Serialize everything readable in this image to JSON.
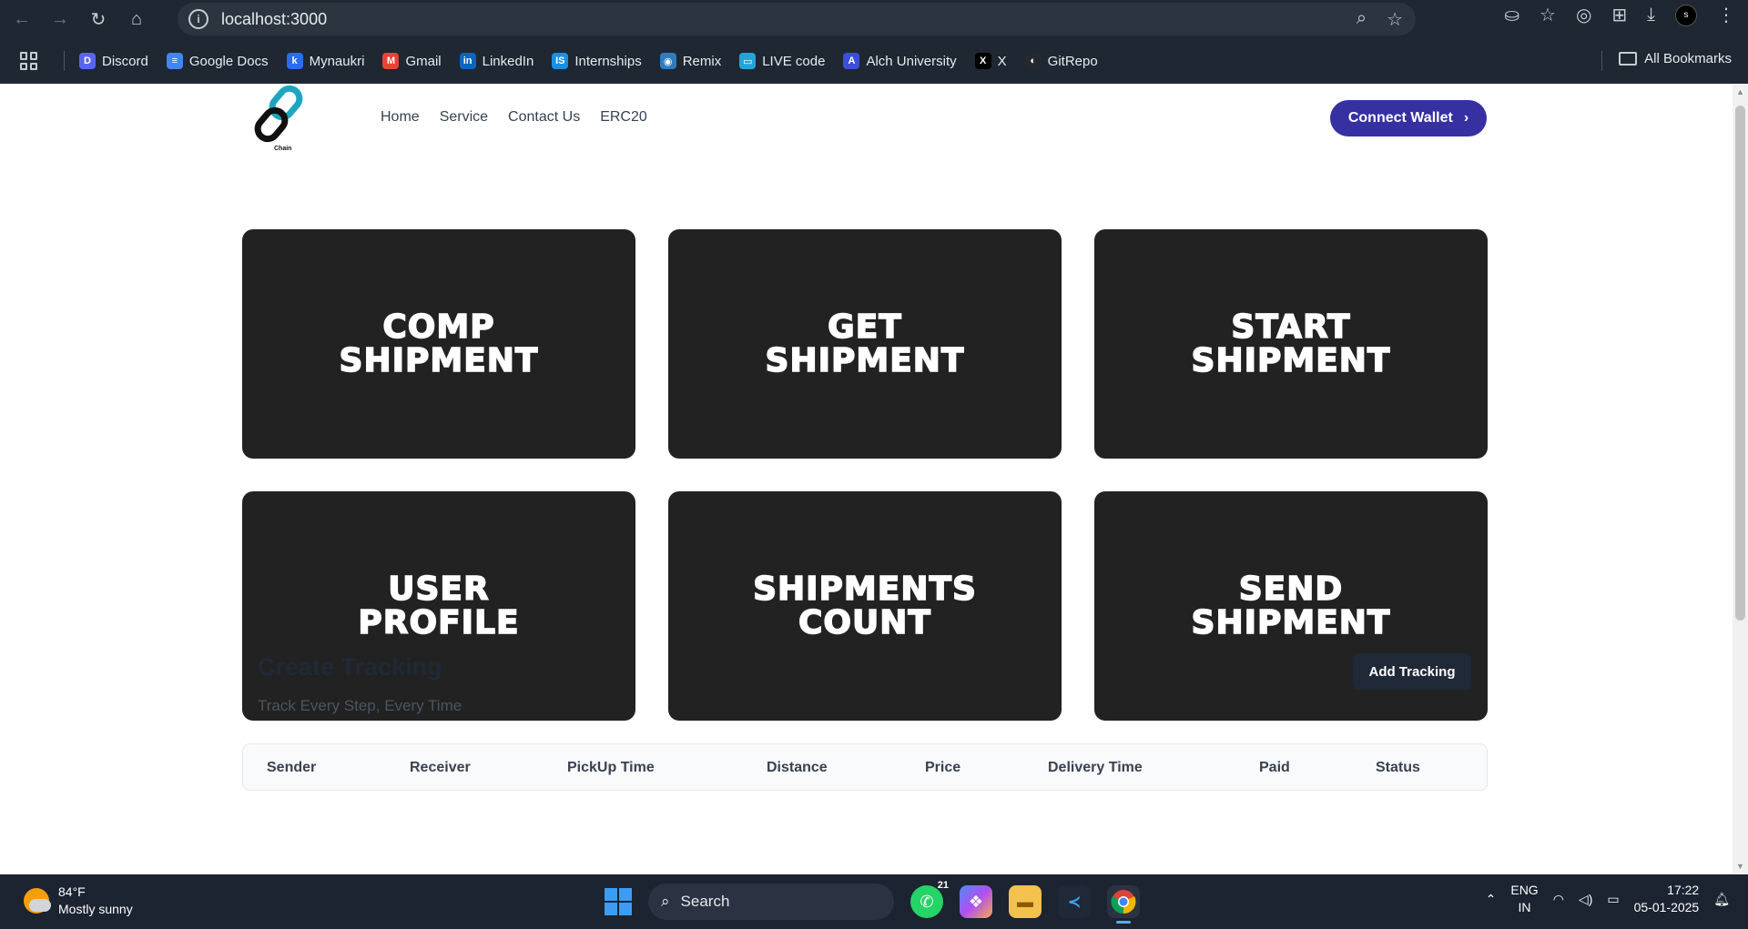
{
  "browser": {
    "url": "localhost:3000",
    "bookmarks": [
      {
        "label": "Discord",
        "color": "#5865f2",
        "glyph": "D"
      },
      {
        "label": "Google Docs",
        "color": "#4285f4",
        "glyph": "≡"
      },
      {
        "label": "Mynaukri",
        "color": "#2b6cf0",
        "glyph": "k"
      },
      {
        "label": "Gmail",
        "color": "#ea4335",
        "glyph": "M"
      },
      {
        "label": "LinkedIn",
        "color": "#0a66c2",
        "glyph": "in"
      },
      {
        "label": "Internships",
        "color": "#1d8fe1",
        "glyph": "IS"
      },
      {
        "label": "Remix",
        "color": "#2e7dbe",
        "glyph": "◉"
      },
      {
        "label": "LIVE code",
        "color": "#22a6d8",
        "glyph": "▭"
      },
      {
        "label": "Alch University",
        "color": "#3b4fd8",
        "glyph": "A"
      },
      {
        "label": "X",
        "color": "#000000",
        "glyph": "X"
      },
      {
        "label": "GitRepo",
        "color": "#24292e",
        "glyph": "◐"
      }
    ],
    "all_bookmarks": "All Bookmarks",
    "avatar_letter": "s"
  },
  "site": {
    "logo_text": "Chain",
    "nav": [
      "Home",
      "Service",
      "Contact Us",
      "ERC20"
    ],
    "connect_label": "Connect Wallet",
    "cards": [
      "COMP SHIPMENT",
      "GET SHIPMENT",
      "START SHIPMENT",
      "USER PROFILE",
      "SHIPMENTS COUNT",
      "SEND SHIPMENT"
    ],
    "tracking": {
      "title": "Create Tracking",
      "subtitle": "Track Every Step, Every Time",
      "add_label": "Add Tracking",
      "columns": [
        "Sender",
        "Receiver",
        "PickUp Time",
        "Distance",
        "Price",
        "Delivery Time",
        "Paid",
        "Status"
      ]
    }
  },
  "taskbar": {
    "temp": "84°F",
    "weather": "Mostly sunny",
    "search_placeholder": "Search",
    "whatsapp_badge": "21",
    "lang1": "ENG",
    "lang2": "IN",
    "time": "17:22",
    "date": "05-01-2025"
  },
  "colors": {
    "accent": "#3730a3",
    "card": "#222222",
    "chrome": "#1f2733"
  }
}
